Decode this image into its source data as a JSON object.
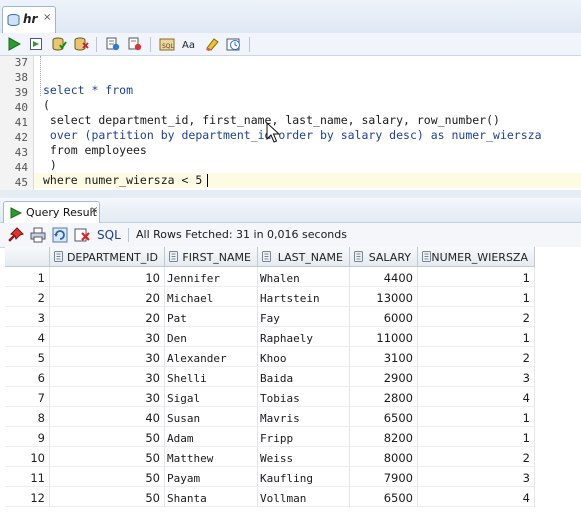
{
  "tab": {
    "title": "hr",
    "close": "×"
  },
  "toolbar": {
    "icons": [
      "run-statement-icon",
      "run-script-icon",
      "commit-icon",
      "rollback-icon",
      "explain-plan-icon",
      "autotrace-icon",
      "sql-tuning-icon",
      "format-case-icon",
      "clear-icon",
      "history-icon"
    ]
  },
  "editor": {
    "lines": [
      {
        "n": "37",
        "code": ""
      },
      {
        "n": "38",
        "code": ""
      },
      {
        "n": "39",
        "code": "select * from"
      },
      {
        "n": "40",
        "code": "("
      },
      {
        "n": "41",
        "code": " select department_id, first_name, last_name, salary, row_number()"
      },
      {
        "n": "42",
        "code": " over (partition by department_id order by salary desc) as numer_wiersza"
      },
      {
        "n": "43",
        "code": " from employees"
      },
      {
        "n": "44",
        "code": " )"
      },
      {
        "n": "45",
        "code": "where numer_wiersza < 5"
      }
    ]
  },
  "result_tab": {
    "label": "Query Result",
    "close": "×"
  },
  "result_toolbar": {
    "sql_label": "SQL",
    "status": "All Rows Fetched: 31 in 0,016 seconds"
  },
  "grid": {
    "columns": [
      "DEPARTMENT_ID",
      "FIRST_NAME",
      "LAST_NAME",
      "SALARY",
      "NUMER_WIERSZA"
    ],
    "rows": [
      {
        "rn": "1",
        "dept": "10",
        "first": "Jennifer",
        "last": "Whalen",
        "salary": "4400",
        "num": "1"
      },
      {
        "rn": "2",
        "dept": "20",
        "first": "Michael",
        "last": "Hartstein",
        "salary": "13000",
        "num": "1"
      },
      {
        "rn": "3",
        "dept": "20",
        "first": "Pat",
        "last": "Fay",
        "salary": "6000",
        "num": "2"
      },
      {
        "rn": "4",
        "dept": "30",
        "first": "Den",
        "last": "Raphaely",
        "salary": "11000",
        "num": "1"
      },
      {
        "rn": "5",
        "dept": "30",
        "first": "Alexander",
        "last": "Khoo",
        "salary": "3100",
        "num": "2"
      },
      {
        "rn": "6",
        "dept": "30",
        "first": "Shelli",
        "last": "Baida",
        "salary": "2900",
        "num": "3"
      },
      {
        "rn": "7",
        "dept": "30",
        "first": "Sigal",
        "last": "Tobias",
        "salary": "2800",
        "num": "4"
      },
      {
        "rn": "8",
        "dept": "40",
        "first": "Susan",
        "last": "Mavris",
        "salary": "6500",
        "num": "1"
      },
      {
        "rn": "9",
        "dept": "50",
        "first": "Adam",
        "last": "Fripp",
        "salary": "8200",
        "num": "1"
      },
      {
        "rn": "10",
        "dept": "50",
        "first": "Matthew",
        "last": "Weiss",
        "salary": "8000",
        "num": "2"
      },
      {
        "rn": "11",
        "dept": "50",
        "first": "Payam",
        "last": "Kaufling",
        "salary": "7900",
        "num": "3"
      },
      {
        "rn": "12",
        "dept": "50",
        "first": "Shanta",
        "last": "Vollman",
        "salary": "6500",
        "num": "4"
      }
    ]
  },
  "colors": {
    "keyword": "#1f3f9e",
    "current_line": "#fcfbe3",
    "sql_link": "#1c3f8f"
  }
}
